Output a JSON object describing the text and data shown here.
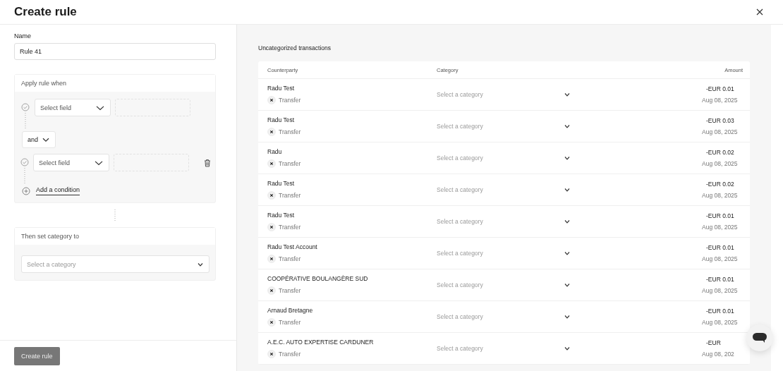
{
  "title": "Create rule",
  "rule_form": {
    "name_label": "Name",
    "name_value": "Rule 41",
    "conditions_title": "Apply rule when",
    "conditions": [
      {
        "field_placeholder": "Select field",
        "deletable": false
      },
      {
        "field_placeholder": "Select field",
        "deletable": true
      }
    ],
    "joiner": "and",
    "add_condition": "Add a condition",
    "action_title": "Then set category to",
    "category_placeholder": "Select a category",
    "submit": {
      "label": "Create rule",
      "disabled": true
    }
  },
  "transactions": {
    "title": "Uncategorized transactions",
    "columns": [
      "Counterparty",
      "Category",
      "Amount"
    ],
    "rows": [
      {
        "counterparty": "Radu Test",
        "type": "Transfer",
        "category_placeholder": "Select a category",
        "amount": "-EUR 0.01",
        "date": "Aug 08, 2025"
      },
      {
        "counterparty": "Radu Test",
        "type": "Transfer",
        "category_placeholder": "Select a category",
        "amount": "-EUR 0.03",
        "date": "Aug 08, 2025"
      },
      {
        "counterparty": "Radu",
        "type": "Transfer",
        "category_placeholder": "Select a category",
        "amount": "-EUR 0.02",
        "date": "Aug 08, 2025"
      },
      {
        "counterparty": "Radu Test",
        "type": "Transfer",
        "category_placeholder": "Select a category",
        "amount": "-EUR 0.02",
        "date": "Aug 08, 2025"
      },
      {
        "counterparty": "Radu Test",
        "type": "Transfer",
        "category_placeholder": "Select a category",
        "amount": "-EUR 0.01",
        "date": "Aug 08, 2025"
      },
      {
        "counterparty": "Radu Test Account",
        "type": "Transfer",
        "category_placeholder": "Select a category",
        "amount": "-EUR 0.01",
        "date": "Aug 08, 2025"
      },
      {
        "counterparty": "COOPÉRATIVE BOULANGÈRE SUD",
        "type": "Transfer",
        "category_placeholder": "Select a category",
        "amount": "-EUR 0.01",
        "date": "Aug 08, 2025"
      },
      {
        "counterparty": "Arnaud Bretagne",
        "type": "Transfer",
        "category_placeholder": "Select a category",
        "amount": "-EUR 0.01",
        "date": "Aug 08, 2025"
      },
      {
        "counterparty": "A.E.C. AUTO EXPERTISE CARDUNER",
        "type": "Transfer",
        "category_placeholder": "Select a category",
        "amount": "-EUR",
        "date": "Aug 08, 202"
      }
    ]
  }
}
